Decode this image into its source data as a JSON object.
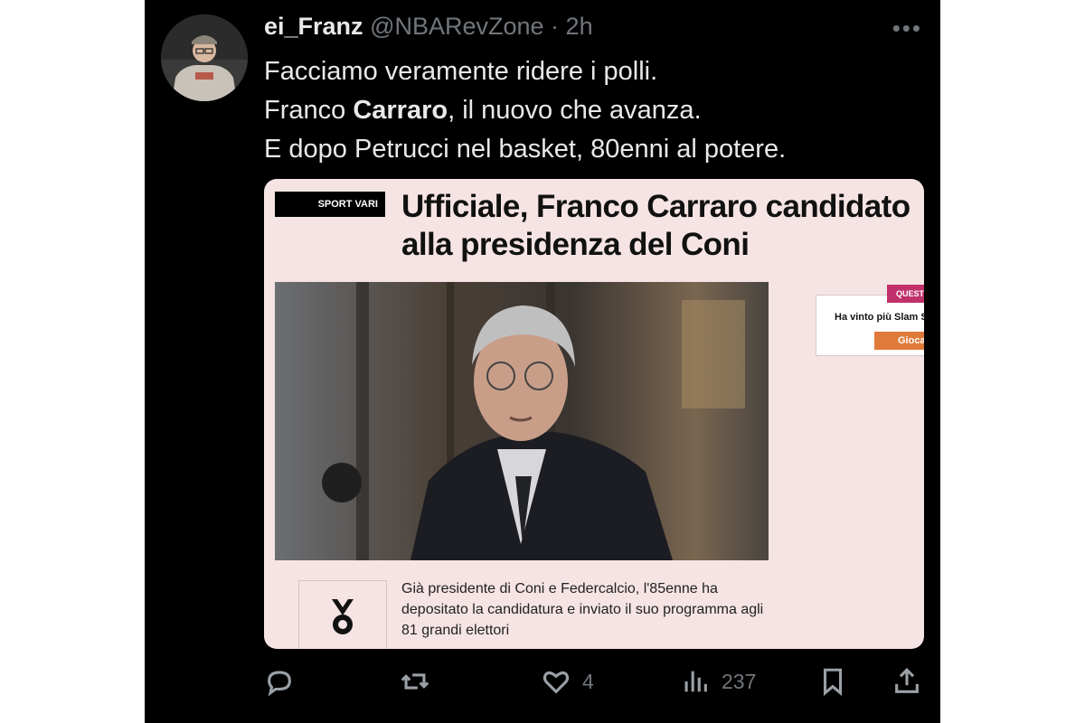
{
  "tweet": {
    "author_name": "ei_Franz",
    "author_handle": "@NBARevZone",
    "separator": " · ",
    "time": "2h",
    "text_line1": "Facciamo veramente ridere i polli.",
    "text_line2_pre": "Franco ",
    "text_line2_bold": "Carraro",
    "text_line2_post": ", il nuovo che avanza.",
    "text_line3": "E dopo Petrucci nel basket, 80enni al potere."
  },
  "card": {
    "category": "SPORT VARI",
    "headline_line1": "Ufficiale, Franco Carraro candidato",
    "headline_line2": "alla presidenza del Coni",
    "ad_badge": "QUEST",
    "ad_badge_sub": "QU",
    "ad_text": "Ha vinto più Slam S",
    "ad_button": "Gioca",
    "summary": "Già presidente di Coni e Federcalcio, l'85enne ha depositato la candidatura e inviato il suo programma agli 81 grandi elettori"
  },
  "actions": {
    "reply_count": "",
    "retweet_count": "",
    "like_count": "4",
    "views_count": "237"
  },
  "icons": {
    "more": "more-horizontal-icon",
    "reply": "reply-icon",
    "retweet": "retweet-icon",
    "like": "heart-icon",
    "views": "views-chart-icon",
    "bookmark": "bookmark-icon",
    "share": "share-icon",
    "medal": "medal-icon"
  },
  "colors": {
    "background": "#000000",
    "text": "#e7e9ea",
    "muted": "#71767b",
    "card_bg": "#f6e4e4",
    "ad_button": "#e07a3a",
    "ad_badge": "#c0306a"
  }
}
